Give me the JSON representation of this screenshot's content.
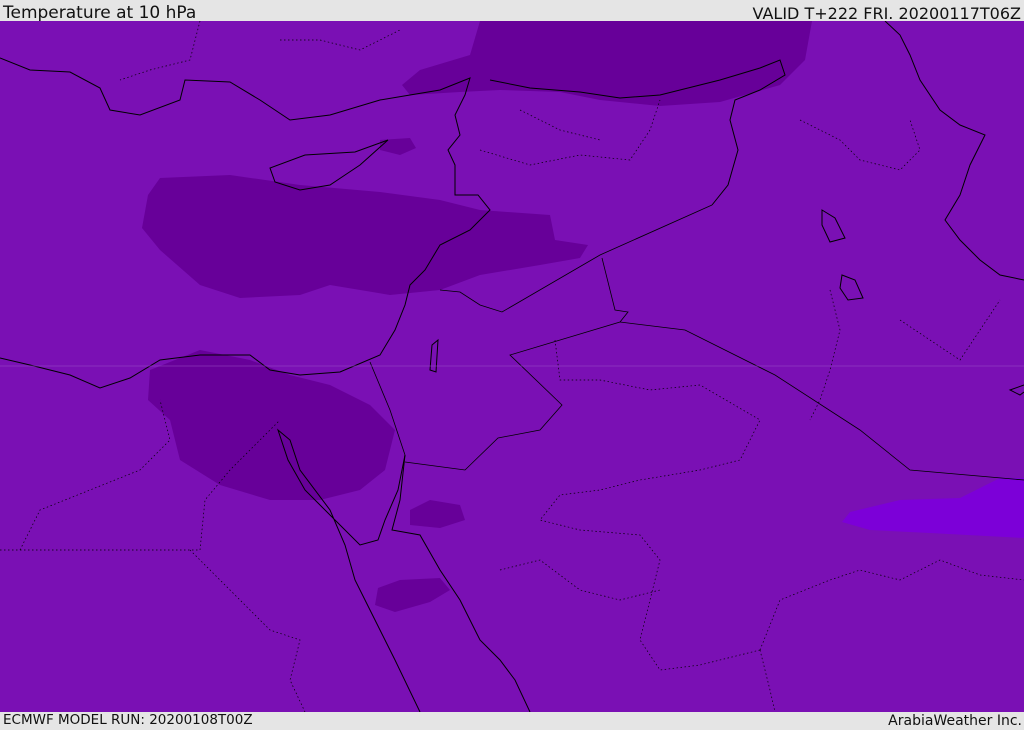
{
  "header": {
    "title": "Temperature at 10 hPa",
    "valid": "VALID T+222 FRI. 20200117T06Z"
  },
  "footer": {
    "model_run": "ECMWF MODEL RUN: 20200108T00Z",
    "credit": "ArabiaWeather Inc."
  },
  "colors": {
    "base": "#7a10b4",
    "cold": "#670099",
    "warm": "#7c00d8",
    "lines": "#000000"
  }
}
